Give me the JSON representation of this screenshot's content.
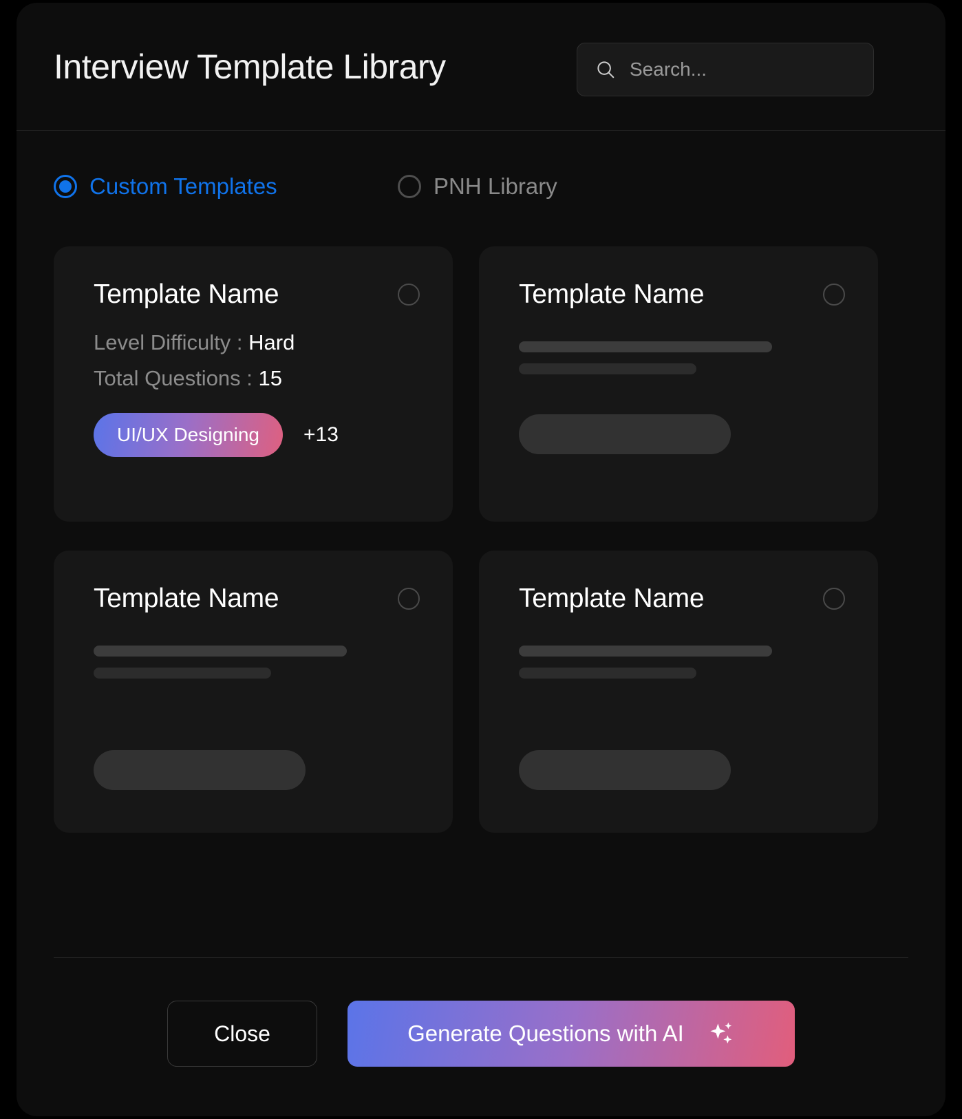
{
  "header": {
    "title": "Interview Template Library",
    "search": {
      "placeholder": "Search...",
      "value": "",
      "icon": "search-icon"
    }
  },
  "filters": {
    "options": [
      {
        "label": "Custom Templates",
        "selected": true
      },
      {
        "label": "PNH Library",
        "selected": false
      }
    ],
    "accent_color": "#1073EA"
  },
  "cards": [
    {
      "title": "Template Name",
      "detailed": true,
      "difficulty_label": "Level Difficulty : ",
      "difficulty_value": "Hard",
      "questions_label": "Total Questions : ",
      "questions_value": "15",
      "tag": "UI/UX Designing",
      "tag_more": "+13",
      "selected": false
    },
    {
      "title": "Template Name",
      "detailed": false,
      "selected": false
    },
    {
      "title": "Template Name",
      "detailed": false,
      "selected": false
    },
    {
      "title": "Template Name",
      "detailed": false,
      "selected": false
    }
  ],
  "footer": {
    "close_label": "Close",
    "generate_label": "Generate Questions with AI",
    "generate_icon": "sparkle-icon",
    "gradient_start": "#5B74E8",
    "gradient_end": "#E15E7C"
  }
}
